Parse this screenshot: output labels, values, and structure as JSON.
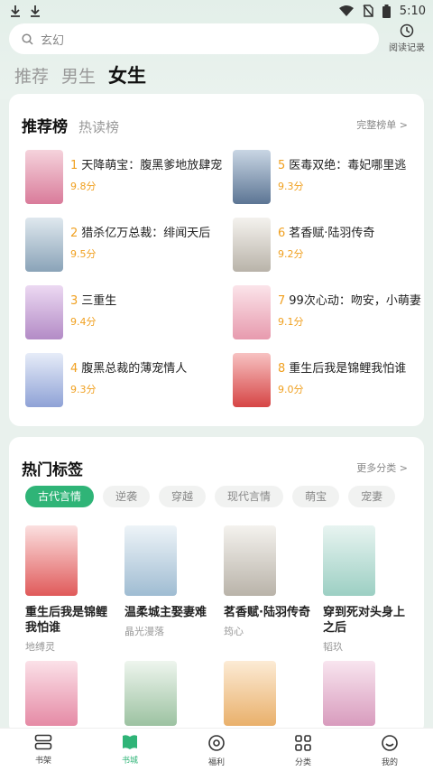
{
  "status": {
    "time": "5:10"
  },
  "search": {
    "placeholder": "玄幻"
  },
  "history": {
    "label": "阅读记录"
  },
  "tabs": [
    {
      "label": "推荐"
    },
    {
      "label": "男生"
    },
    {
      "label": "女生"
    }
  ],
  "rank": {
    "title": "推荐榜",
    "alt_title": "热读榜",
    "more": "完整榜单 >",
    "items": [
      {
        "num": "1",
        "title": "天降萌宝：腹黑爹地放肆宠",
        "score": "9.8分",
        "color": "#e7a8b9"
      },
      {
        "num": "2",
        "title": "猎杀亿万总裁：绯闻天后",
        "score": "9.5分",
        "color": "#9fb7c9"
      },
      {
        "num": "3",
        "title": "三重生",
        "score": "9.4分",
        "color": "#c9a7d6"
      },
      {
        "num": "4",
        "title": "腹黑总裁的薄宠情人",
        "score": "9.3分",
        "color": "#a5b5dd"
      },
      {
        "num": "5",
        "title": "医毒双绝：毒妃哪里逃",
        "score": "9.3分",
        "color": "#7f95b3"
      },
      {
        "num": "6",
        "title": "茗香赋·陆羽传奇",
        "score": "9.2分",
        "color": "#d9d5cf"
      },
      {
        "num": "7",
        "title": "99次心动：吻安，小萌妻",
        "score": "9.1分",
        "color": "#f2c0cc"
      },
      {
        "num": "8",
        "title": "重生后我是锦鲤我怕谁",
        "score": "9.0分",
        "color": "#e86b6b"
      }
    ]
  },
  "tags": {
    "title": "热门标签",
    "more": "更多分类 >",
    "chips": [
      {
        "label": "古代言情"
      },
      {
        "label": "逆袭"
      },
      {
        "label": "穿越"
      },
      {
        "label": "现代言情"
      },
      {
        "label": "萌宝"
      },
      {
        "label": "宠妻"
      }
    ],
    "books": [
      {
        "title": "重生后我是锦鲤我怕谁",
        "author": "地缚灵",
        "color": "#e86b6b"
      },
      {
        "title": "温柔城主娶妻难",
        "author": "晶光漫落",
        "color": "#b8cfe0"
      },
      {
        "title": "茗香赋·陆羽传奇",
        "author": "筠心",
        "color": "#d9d5cf"
      },
      {
        "title": "穿到死对头身上之后",
        "author": "韬玖",
        "color": "#c8e2dc"
      }
    ],
    "books2": [
      {
        "color": "#f0b3c4"
      },
      {
        "color": "#b5cfb8"
      },
      {
        "color": "#f3cc9c"
      },
      {
        "color": "#e6b5cf"
      }
    ]
  },
  "nav": [
    {
      "label": "书架"
    },
    {
      "label": "书城"
    },
    {
      "label": "福利"
    },
    {
      "label": "分类"
    },
    {
      "label": "我的"
    }
  ]
}
